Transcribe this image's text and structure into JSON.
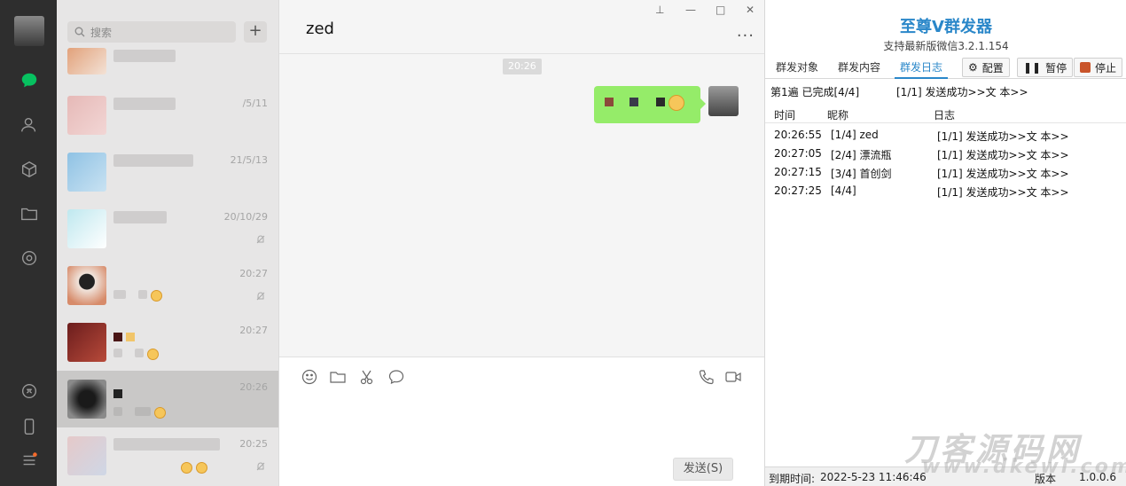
{
  "search": {
    "placeholder": "搜索",
    "add_label": "+"
  },
  "chat_list": [
    {
      "time": ""
    },
    {
      "time": "/5/11"
    },
    {
      "time": "21/5/13"
    },
    {
      "time": "20/10/29",
      "muted": true
    },
    {
      "time": "20:27",
      "muted": true
    },
    {
      "time": "20:27"
    },
    {
      "time": "20:26"
    },
    {
      "time": "20:25",
      "muted": true
    }
  ],
  "chat": {
    "title": "zed",
    "timestamp": "20:26",
    "send_label": "发送(S)",
    "window_controls": [
      "pin",
      "minimize",
      "maximize",
      "close"
    ]
  },
  "panel": {
    "title": "至尊V群发器",
    "subtitle": "支持最新版微信3.2.1.154",
    "tabs": [
      "群发对象",
      "群发内容",
      "群发日志"
    ],
    "active_tab": "群发日志",
    "buttons": {
      "config": "配置",
      "pause": "暂停",
      "stop": "停止"
    },
    "status_round": "第1遍 已完成[4/4]",
    "status_result": "[1/1] 发送成功>>文  本>>",
    "columns": [
      "时间",
      "昵称",
      "日志"
    ],
    "rows": [
      {
        "time": "20:26:55",
        "nick": "[1/4] zed",
        "log": "[1/1] 发送成功>>文  本>>"
      },
      {
        "time": "20:27:05",
        "nick": "[2/4] 漂流瓶",
        "log": "[1/1] 发送成功>>文  本>>"
      },
      {
        "time": "20:27:15",
        "nick": "[3/4] 首创剑",
        "log": "[1/1] 发送成功>>文  本>>"
      },
      {
        "time": "20:27:25",
        "nick": "[4/4]",
        "log": "[1/1] 发送成功>>文  本>>"
      }
    ],
    "expire_label": "到期时间:",
    "expire_value": "2022-5-23 11:46:46",
    "version_label": "版本",
    "version_value": "1.0.0.6"
  },
  "watermark": {
    "line1": "刀客源码网",
    "line2": "www.dkewl.com"
  },
  "colors": {
    "accent": "#2a87c9",
    "bubble": "#95ec69",
    "rail": "#2e2e2e",
    "wechat_green": "#07c160",
    "stop": "#c9542a"
  }
}
